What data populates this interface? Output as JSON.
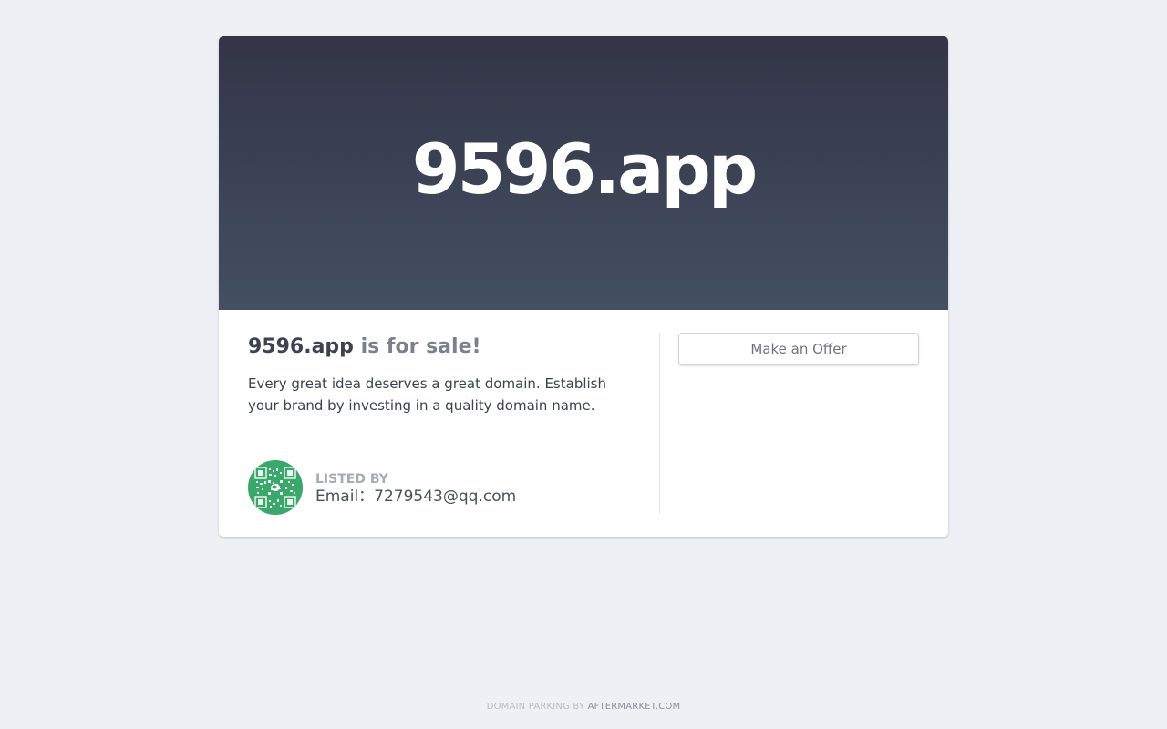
{
  "domain": "9596.app",
  "headline": {
    "domain": "9596.app",
    "suffix": " is for sale!"
  },
  "description": "Every great idea deserves a great domain. Establish your brand by investing in a quality domain name.",
  "lister": {
    "label": "LISTED BY",
    "contact": "Email：7279543@qq.com",
    "avatar_icon": "qr-code-icon",
    "avatar_color": "#3aa86a"
  },
  "actions": {
    "make_offer_label": "Make an Offer"
  },
  "footer": {
    "prefix": "DOMAIN PARKING BY ",
    "link_label": "AFTERMARKET.COM"
  },
  "colors": {
    "page_background": "#edf0f5",
    "hero_gradient_top": "#333546",
    "hero_gradient_bottom": "#444f62"
  }
}
